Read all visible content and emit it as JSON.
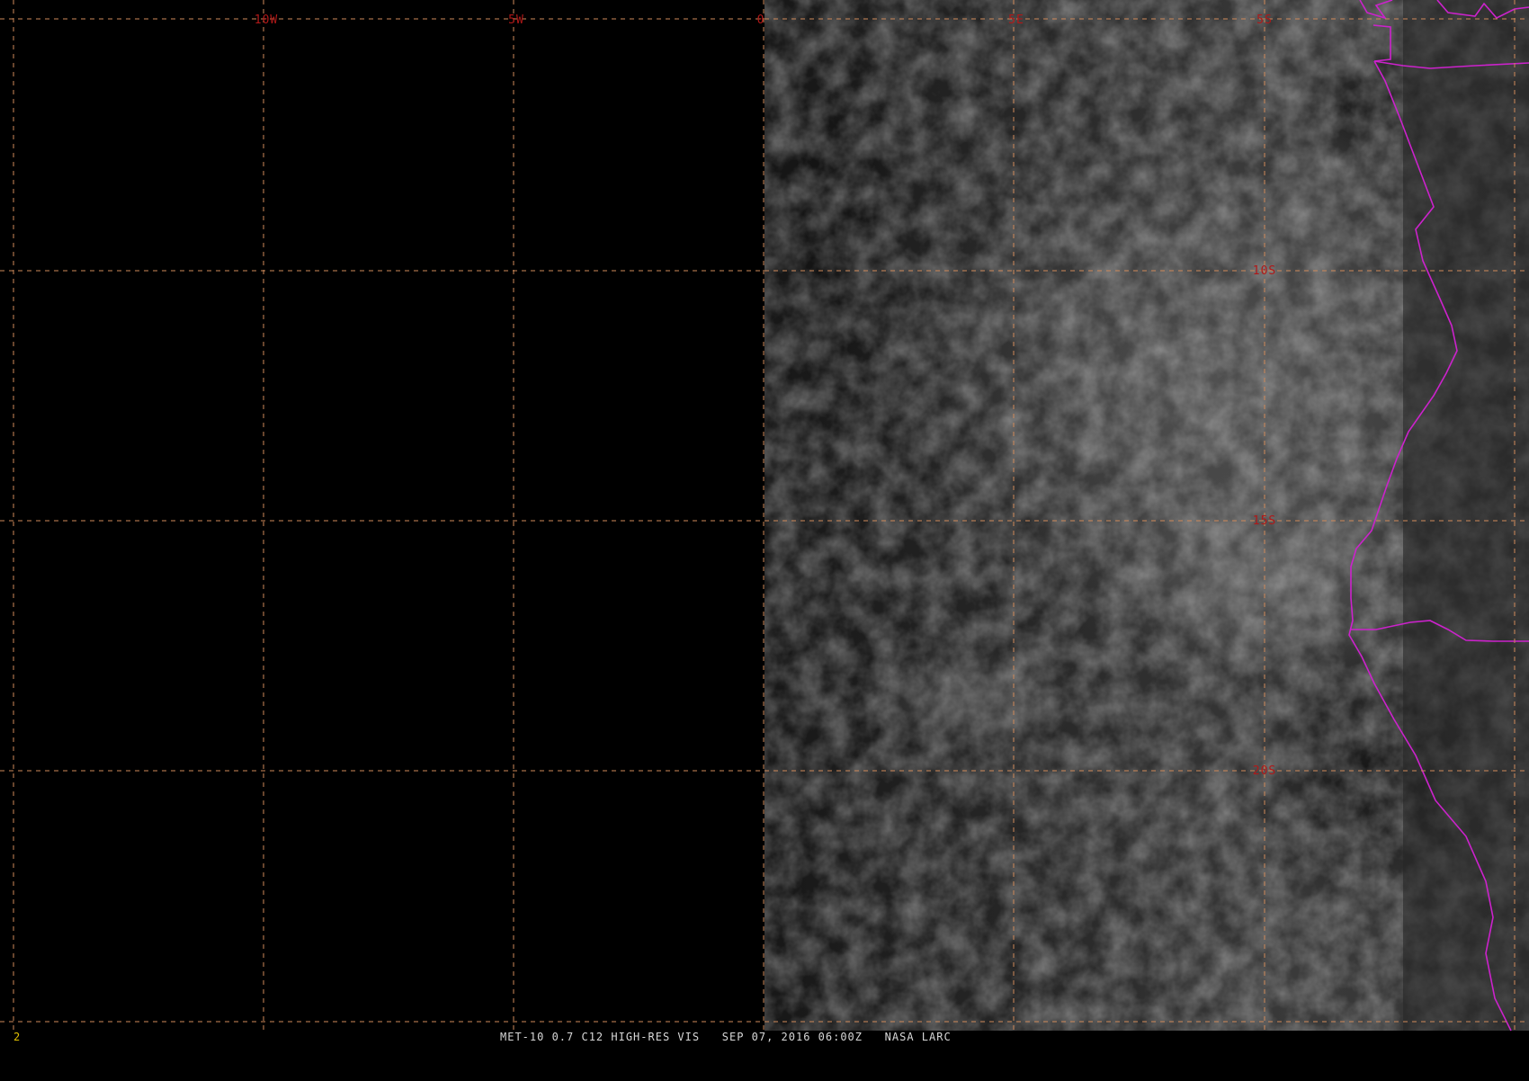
{
  "grid": {
    "longitude_labels": [
      "10W",
      "5W",
      "0",
      "5E",
      "5S"
    ],
    "latitude_labels": [
      "10S",
      "15S",
      "20S"
    ],
    "line_color": "#d08a5a",
    "label_color": "#b01818"
  },
  "map": {
    "border_color": "#cc22cc",
    "day_region": "east of 0"
  },
  "status": {
    "frame": "2",
    "text": "MET-10 0.7 C12 HIGH-RES VIS   SEP 07, 2016 06:00Z   NASA LARC",
    "frame_color": "#e0c000",
    "text_color": "#d8d8d8"
  }
}
